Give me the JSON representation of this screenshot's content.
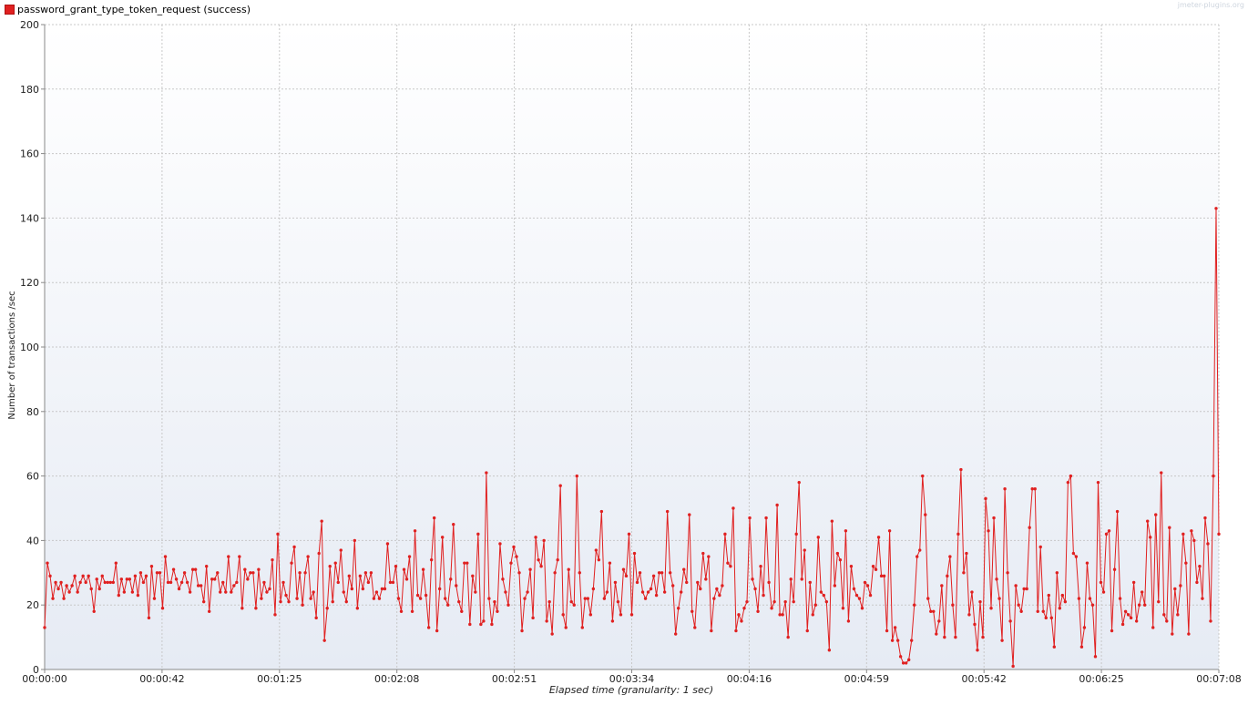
{
  "legend": {
    "label": "password_grant_type_token_request (success)",
    "color": "#e02020"
  },
  "watermark": "jmeter-plugins.org",
  "chart_data": {
    "type": "line",
    "title": "",
    "xlabel": "Elapsed time (granularity: 1 sec)",
    "ylabel": "Number of transactions /sec",
    "ylim": [
      0,
      200
    ],
    "y_ticks": [
      0,
      20,
      40,
      60,
      80,
      100,
      120,
      140,
      160,
      180,
      200
    ],
    "x_range_seconds": [
      0,
      428
    ],
    "x_tick_labels": [
      "00:00:00",
      "00:00:42",
      "00:01:25",
      "00:02:08",
      "00:02:51",
      "00:03:34",
      "00:04:16",
      "00:04:59",
      "00:05:42",
      "00:06:25",
      "00:07:08"
    ],
    "grid": true,
    "legend_position": "top-left",
    "series": [
      {
        "name": "password_grant_type_token_request (success)",
        "color": "#e02020",
        "x_start": 0,
        "x_step": 1,
        "values": [
          13,
          33,
          29,
          22,
          27,
          25,
          27,
          22,
          26,
          24,
          26,
          29,
          24,
          27,
          29,
          27,
          29,
          25,
          18,
          28,
          25,
          29,
          27,
          27,
          27,
          27,
          33,
          23,
          28,
          24,
          28,
          28,
          24,
          29,
          23,
          30,
          27,
          29,
          16,
          32,
          22,
          30,
          30,
          19,
          35,
          27,
          27,
          31,
          28,
          25,
          27,
          30,
          27,
          24,
          31,
          31,
          26,
          26,
          21,
          32,
          18,
          28,
          28,
          30,
          24,
          27,
          24,
          35,
          24,
          26,
          27,
          35,
          19,
          31,
          28,
          30,
          30,
          19,
          31,
          22,
          27,
          24,
          25,
          34,
          17,
          42,
          21,
          27,
          23,
          21,
          33,
          38,
          22,
          30,
          20,
          30,
          35,
          22,
          24,
          16,
          36,
          46,
          9,
          19,
          32,
          21,
          33,
          27,
          37,
          24,
          21,
          29,
          25,
          40,
          19,
          29,
          25,
          30,
          27,
          30,
          22,
          24,
          22,
          25,
          25,
          39,
          27,
          27,
          32,
          22,
          18,
          31,
          28,
          35,
          18,
          43,
          23,
          22,
          31,
          23,
          13,
          34,
          47,
          12,
          25,
          41,
          22,
          20,
          28,
          45,
          26,
          21,
          18,
          33,
          33,
          14,
          29,
          24,
          42,
          14,
          15,
          61,
          22,
          14,
          21,
          18,
          39,
          28,
          24,
          20,
          33,
          38,
          35,
          30,
          12,
          22,
          24,
          31,
          16,
          41,
          34,
          32,
          40,
          15,
          21,
          11,
          30,
          34,
          57,
          17,
          13,
          31,
          21,
          20,
          60,
          30,
          13,
          22,
          22,
          17,
          25,
          37,
          34,
          49,
          22,
          24,
          33,
          15,
          27,
          21,
          17,
          31,
          29,
          42,
          17,
          36,
          27,
          30,
          24,
          22,
          24,
          25,
          29,
          23,
          30,
          30,
          24,
          49,
          30,
          26,
          11,
          19,
          24,
          31,
          27,
          48,
          18,
          13,
          27,
          25,
          36,
          28,
          35,
          12,
          22,
          25,
          23,
          26,
          42,
          33,
          32,
          50,
          12,
          17,
          15,
          19,
          21,
          47,
          28,
          25,
          18,
          32,
          23,
          47,
          27,
          19,
          21,
          51,
          17,
          17,
          21,
          10,
          28,
          21,
          42,
          58,
          28,
          37,
          12,
          27,
          17,
          20,
          41,
          24,
          23,
          21,
          6,
          46,
          26,
          36,
          34,
          19,
          43,
          15,
          32,
          25,
          23,
          22,
          19,
          27,
          26,
          23,
          32,
          31,
          41,
          29,
          29,
          12,
          43,
          9,
          13,
          9,
          4,
          2,
          2,
          3,
          9,
          20,
          35,
          37,
          60,
          48,
          22,
          18,
          18,
          11,
          15,
          26,
          10,
          29,
          35,
          20,
          10,
          42,
          62,
          30,
          36,
          17,
          24,
          14,
          6,
          21,
          10,
          53,
          43,
          19,
          47,
          28,
          22,
          9,
          56,
          30,
          15,
          1,
          26,
          20,
          18,
          25,
          25,
          44,
          56,
          56,
          18,
          38,
          18,
          16,
          23,
          16,
          7,
          30,
          19,
          23,
          21,
          58,
          60,
          36,
          35,
          22,
          7,
          13,
          33,
          22,
          20,
          4,
          58,
          27,
          24,
          42,
          43,
          12,
          31,
          49,
          22,
          14,
          18,
          17,
          16,
          27,
          15,
          20,
          24,
          20,
          46,
          41,
          13,
          48,
          21,
          61,
          17,
          15,
          44,
          11,
          25,
          17,
          26,
          42,
          33,
          11,
          43,
          40,
          27,
          32,
          22,
          47,
          39,
          15,
          60,
          143,
          42
        ]
      }
    ]
  }
}
